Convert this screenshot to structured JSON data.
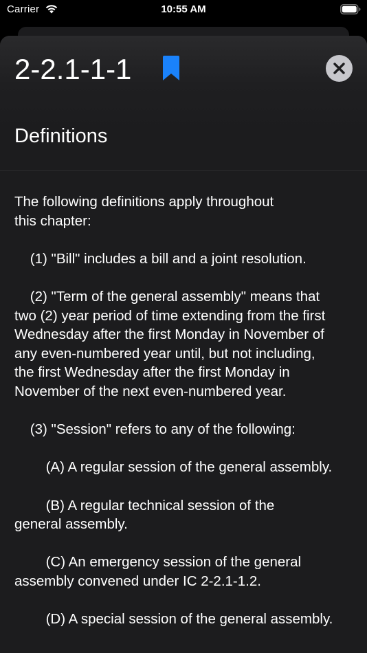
{
  "status_bar": {
    "carrier": "Carrier",
    "time": "10:55 AM",
    "wifi_icon": "wifi-icon",
    "battery_icon": "battery-icon"
  },
  "header": {
    "section_number": "2-2.1-1-1",
    "bookmark_icon": "bookmark-icon",
    "bookmark_color": "#1a82fb",
    "close_icon": "close-icon",
    "title": "Definitions"
  },
  "body": {
    "paragraphs": [
      "The following definitions apply throughout\nthis chapter:",
      "    (1) \"Bill\" includes a bill and a joint resolution.",
      "    (2) \"Term of the general assembly\" means that\ntwo (2) year period of time extending from the first\nWednesday after the first Monday in November of\nany even-numbered year until, but not including,\nthe first Wednesday after the first Monday in\nNovember of the next even-numbered year.",
      "    (3) \"Session\" refers to any of the following:",
      "        (A) A regular session of the general assembly.",
      "        (B) A regular technical session of the\ngeneral assembly.",
      "        (C) An emergency session of the general\nassembly convened under IC 2-2.1-1.2.",
      "        (D) A special session of the general assembly."
    ]
  },
  "colors": {
    "background": "#1c1c1e",
    "accent": "#1a82fb",
    "text": "#ffffff"
  }
}
